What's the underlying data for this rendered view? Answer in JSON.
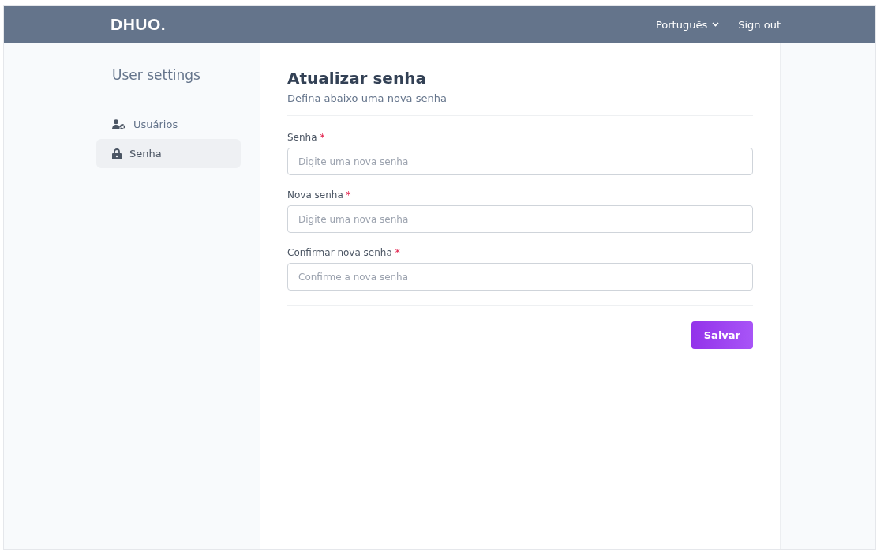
{
  "header": {
    "logo": "DHUO.",
    "language": "Português",
    "sign_out": "Sign out"
  },
  "sidebar": {
    "title": "User settings",
    "items": [
      {
        "label": "Usuários",
        "selected": false
      },
      {
        "label": "Senha",
        "selected": true
      }
    ]
  },
  "form": {
    "title": "Atualizar senha",
    "subtitle": "Defina abaixo uma nova senha",
    "fields": [
      {
        "label": "Senha",
        "required_mark": "*",
        "placeholder": "Digite uma nova senha"
      },
      {
        "label": "Nova senha",
        "required_mark": "*",
        "placeholder": "Digite uma nova senha"
      },
      {
        "label": "Confirmar nova senha",
        "required_mark": "*",
        "placeholder": "Confirme a nova senha"
      }
    ],
    "submit": "Salvar"
  }
}
